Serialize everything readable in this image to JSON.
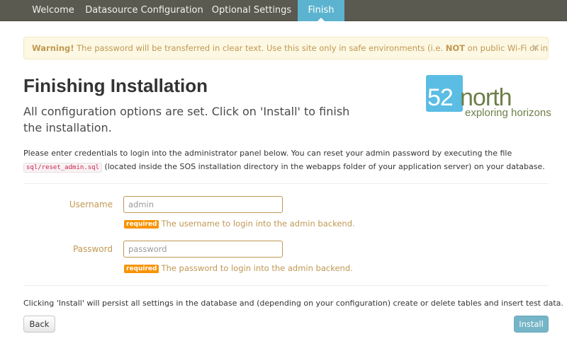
{
  "nav": {
    "tabs": [
      {
        "label": "Welcome"
      },
      {
        "label": "Datasource Configuration"
      },
      {
        "label": "Optional Settings"
      },
      {
        "label": "Finish",
        "active": true
      }
    ]
  },
  "alert": {
    "strong": "Warning!",
    "text_before": " The password will be transferred in clear text. Use this site only in safe environments (i.e. ",
    "emphasis": "NOT",
    "text_after": " on public Wi-Fi or internet cafés)!",
    "close": "×"
  },
  "header": {
    "title": "Finishing Installation",
    "lead": "All configuration options are set. Click on 'Install' to finish the installation."
  },
  "logo": {
    "number": "52",
    "name": "north",
    "tagline": "exploring horizons",
    "box_color": "#5bbde3",
    "text_color": "#6e7f49"
  },
  "description": {
    "text_before": "Please enter credentials to login into the administrator panel below. You can reset your admin password by executing the file ",
    "code": "sql/reset_admin.sql",
    "text_after": " (located inside the SOS installation directory in the webapps folder of your application server) on your database."
  },
  "form": {
    "username": {
      "label": "Username",
      "placeholder": "admin",
      "badge": "required",
      "help": "The username to login into the admin backend."
    },
    "password": {
      "label": "Password",
      "placeholder": "password",
      "badge": "required",
      "help": "The password to login into the admin backend."
    }
  },
  "footer": {
    "text": "Clicking 'Install' will persist all settings in the database and (depending on your configuration) create or delete tables and insert test data.",
    "back_label": "Back",
    "install_label": "Install"
  },
  "colors": {
    "nav_bg": "#5a5a50",
    "nav_active": "#5bb3cf",
    "warning_text": "#c09853",
    "warning_bg": "#fcf8e3",
    "badge": "#f89406",
    "install_button": "#75b5c7"
  }
}
